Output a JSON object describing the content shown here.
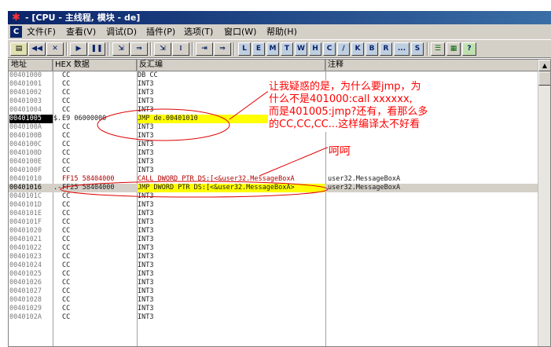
{
  "window": {
    "title": " - [CPU - 主线程, 模块 - de]",
    "app_icon": "ollydbg-bug-icon"
  },
  "menubar": {
    "system_icon_letter": "C",
    "items": [
      "文件(F)",
      "查看(V)",
      "调试(D)",
      "插件(P)",
      "选项(T)",
      "窗口(W)",
      "帮助(H)"
    ]
  },
  "toolbar": {
    "buttons": [
      "open-icon",
      "rewind-icon",
      "close-icon",
      "run-icon",
      "pause-icon",
      "step-into-icon",
      "step-over-icon",
      "trace-into-icon",
      "trace-over-icon",
      "execute-till-return-icon",
      "goto-icon"
    ],
    "letters": [
      "L",
      "E",
      "M",
      "T",
      "W",
      "H",
      "C",
      "/",
      "K",
      "B",
      "R",
      "...",
      "S"
    ],
    "extra": [
      "list-icon",
      "grid-icon",
      "help-icon"
    ],
    "help_label": "?"
  },
  "columns": [
    "地址",
    "HEX 数据",
    "反汇编",
    "注释"
  ],
  "rows": [
    {
      "addr": "00401000",
      "mark": "",
      "hex": "CC",
      "dis": "DB CC",
      "com": ""
    },
    {
      "addr": "00401001",
      "mark": "",
      "hex": "CC",
      "dis": "INT3",
      "com": ""
    },
    {
      "addr": "00401002",
      "mark": "",
      "hex": "CC",
      "dis": "INT3",
      "com": ""
    },
    {
      "addr": "00401003",
      "mark": "",
      "hex": "CC",
      "dis": "INT3",
      "com": ""
    },
    {
      "addr": "00401004",
      "mark": "",
      "hex": "CC",
      "dis": "INT3",
      "com": ""
    },
    {
      "addr": "00401005",
      "mark": "$.",
      "hex": "E9 06000000",
      "dis": "JMP de.00401010",
      "com": ""
    },
    {
      "addr": "0040100A",
      "mark": "",
      "hex": "CC",
      "dis": "INT3",
      "com": ""
    },
    {
      "addr": "0040100B",
      "mark": "",
      "hex": "CC",
      "dis": "INT3",
      "com": ""
    },
    {
      "addr": "0040100C",
      "mark": "",
      "hex": "CC",
      "dis": "INT3",
      "com": ""
    },
    {
      "addr": "0040100D",
      "mark": "",
      "hex": "CC",
      "dis": "INT3",
      "com": ""
    },
    {
      "addr": "0040100E",
      "mark": "",
      "hex": "CC",
      "dis": "INT3",
      "com": ""
    },
    {
      "addr": "0040100F",
      "mark": "",
      "hex": "CC",
      "dis": "INT3",
      "com": ""
    },
    {
      "addr": "00401010",
      "mark": "",
      "hex": "FF15 58404000",
      "dis": "CALL DWORD PTR DS:[<&user32.MessageBoxA",
      "com": "user32.MessageBoxA"
    },
    {
      "addr": "00401016",
      "mark": ".-",
      "hex": "FF25 58404000",
      "dis": "JMP DWORD PTR DS:[<&user32.MessageBoxA>",
      "com": "user32.MessageBoxA"
    },
    {
      "addr": "0040101C",
      "mark": "",
      "hex": "CC",
      "dis": "INT3",
      "com": ""
    },
    {
      "addr": "0040101D",
      "mark": "",
      "hex": "CC",
      "dis": "INT3",
      "com": ""
    },
    {
      "addr": "0040101E",
      "mark": "",
      "hex": "CC",
      "dis": "INT3",
      "com": ""
    },
    {
      "addr": "0040101F",
      "mark": "",
      "hex": "CC",
      "dis": "INT3",
      "com": ""
    },
    {
      "addr": "00401020",
      "mark": "",
      "hex": "CC",
      "dis": "INT3",
      "com": ""
    },
    {
      "addr": "00401021",
      "mark": "",
      "hex": "CC",
      "dis": "INT3",
      "com": ""
    },
    {
      "addr": "00401022",
      "mark": "",
      "hex": "CC",
      "dis": "INT3",
      "com": ""
    },
    {
      "addr": "00401023",
      "mark": "",
      "hex": "CC",
      "dis": "INT3",
      "com": ""
    },
    {
      "addr": "00401024",
      "mark": "",
      "hex": "CC",
      "dis": "INT3",
      "com": ""
    },
    {
      "addr": "00401025",
      "mark": "",
      "hex": "CC",
      "dis": "INT3",
      "com": ""
    },
    {
      "addr": "00401026",
      "mark": "",
      "hex": "CC",
      "dis": "INT3",
      "com": ""
    },
    {
      "addr": "00401027",
      "mark": "",
      "hex": "CC",
      "dis": "INT3",
      "com": ""
    },
    {
      "addr": "00401028",
      "mark": "",
      "hex": "CC",
      "dis": "INT3",
      "com": ""
    },
    {
      "addr": "00401029",
      "mark": "",
      "hex": "CC",
      "dis": "INT3",
      "com": ""
    },
    {
      "addr": "0040102A",
      "mark": "",
      "hex": "CC",
      "dis": "INT3",
      "com": ""
    }
  ],
  "annotations": {
    "question_lines": [
      "让我疑惑的是，为什么要jmp，为",
      "什么不是401000:call xxxxxx,",
      "而是401005:jmp?还有，看那么多",
      "的CC,CC,CC...这样编译太不好看"
    ],
    "laugh": "呵呵",
    "color": "#ff0000"
  },
  "colors": {
    "highlight": "#ffff00",
    "selected_addr_bg": "#000000",
    "title_bar": "#0a246a"
  }
}
